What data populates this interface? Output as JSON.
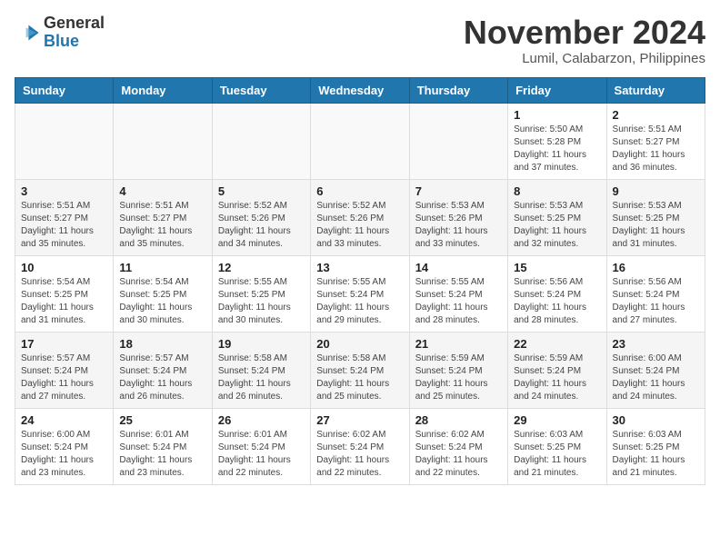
{
  "header": {
    "logo_general": "General",
    "logo_blue": "Blue",
    "month_title": "November 2024",
    "location": "Lumil, Calabarzon, Philippines"
  },
  "weekdays": [
    "Sunday",
    "Monday",
    "Tuesday",
    "Wednesday",
    "Thursday",
    "Friday",
    "Saturday"
  ],
  "weeks": [
    [
      {
        "day": "",
        "info": ""
      },
      {
        "day": "",
        "info": ""
      },
      {
        "day": "",
        "info": ""
      },
      {
        "day": "",
        "info": ""
      },
      {
        "day": "",
        "info": ""
      },
      {
        "day": "1",
        "info": "Sunrise: 5:50 AM\nSunset: 5:28 PM\nDaylight: 11 hours\nand 37 minutes."
      },
      {
        "day": "2",
        "info": "Sunrise: 5:51 AM\nSunset: 5:27 PM\nDaylight: 11 hours\nand 36 minutes."
      }
    ],
    [
      {
        "day": "3",
        "info": "Sunrise: 5:51 AM\nSunset: 5:27 PM\nDaylight: 11 hours\nand 35 minutes."
      },
      {
        "day": "4",
        "info": "Sunrise: 5:51 AM\nSunset: 5:27 PM\nDaylight: 11 hours\nand 35 minutes."
      },
      {
        "day": "5",
        "info": "Sunrise: 5:52 AM\nSunset: 5:26 PM\nDaylight: 11 hours\nand 34 minutes."
      },
      {
        "day": "6",
        "info": "Sunrise: 5:52 AM\nSunset: 5:26 PM\nDaylight: 11 hours\nand 33 minutes."
      },
      {
        "day": "7",
        "info": "Sunrise: 5:53 AM\nSunset: 5:26 PM\nDaylight: 11 hours\nand 33 minutes."
      },
      {
        "day": "8",
        "info": "Sunrise: 5:53 AM\nSunset: 5:25 PM\nDaylight: 11 hours\nand 32 minutes."
      },
      {
        "day": "9",
        "info": "Sunrise: 5:53 AM\nSunset: 5:25 PM\nDaylight: 11 hours\nand 31 minutes."
      }
    ],
    [
      {
        "day": "10",
        "info": "Sunrise: 5:54 AM\nSunset: 5:25 PM\nDaylight: 11 hours\nand 31 minutes."
      },
      {
        "day": "11",
        "info": "Sunrise: 5:54 AM\nSunset: 5:25 PM\nDaylight: 11 hours\nand 30 minutes."
      },
      {
        "day": "12",
        "info": "Sunrise: 5:55 AM\nSunset: 5:25 PM\nDaylight: 11 hours\nand 30 minutes."
      },
      {
        "day": "13",
        "info": "Sunrise: 5:55 AM\nSunset: 5:24 PM\nDaylight: 11 hours\nand 29 minutes."
      },
      {
        "day": "14",
        "info": "Sunrise: 5:55 AM\nSunset: 5:24 PM\nDaylight: 11 hours\nand 28 minutes."
      },
      {
        "day": "15",
        "info": "Sunrise: 5:56 AM\nSunset: 5:24 PM\nDaylight: 11 hours\nand 28 minutes."
      },
      {
        "day": "16",
        "info": "Sunrise: 5:56 AM\nSunset: 5:24 PM\nDaylight: 11 hours\nand 27 minutes."
      }
    ],
    [
      {
        "day": "17",
        "info": "Sunrise: 5:57 AM\nSunset: 5:24 PM\nDaylight: 11 hours\nand 27 minutes."
      },
      {
        "day": "18",
        "info": "Sunrise: 5:57 AM\nSunset: 5:24 PM\nDaylight: 11 hours\nand 26 minutes."
      },
      {
        "day": "19",
        "info": "Sunrise: 5:58 AM\nSunset: 5:24 PM\nDaylight: 11 hours\nand 26 minutes."
      },
      {
        "day": "20",
        "info": "Sunrise: 5:58 AM\nSunset: 5:24 PM\nDaylight: 11 hours\nand 25 minutes."
      },
      {
        "day": "21",
        "info": "Sunrise: 5:59 AM\nSunset: 5:24 PM\nDaylight: 11 hours\nand 25 minutes."
      },
      {
        "day": "22",
        "info": "Sunrise: 5:59 AM\nSunset: 5:24 PM\nDaylight: 11 hours\nand 24 minutes."
      },
      {
        "day": "23",
        "info": "Sunrise: 6:00 AM\nSunset: 5:24 PM\nDaylight: 11 hours\nand 24 minutes."
      }
    ],
    [
      {
        "day": "24",
        "info": "Sunrise: 6:00 AM\nSunset: 5:24 PM\nDaylight: 11 hours\nand 23 minutes."
      },
      {
        "day": "25",
        "info": "Sunrise: 6:01 AM\nSunset: 5:24 PM\nDaylight: 11 hours\nand 23 minutes."
      },
      {
        "day": "26",
        "info": "Sunrise: 6:01 AM\nSunset: 5:24 PM\nDaylight: 11 hours\nand 22 minutes."
      },
      {
        "day": "27",
        "info": "Sunrise: 6:02 AM\nSunset: 5:24 PM\nDaylight: 11 hours\nand 22 minutes."
      },
      {
        "day": "28",
        "info": "Sunrise: 6:02 AM\nSunset: 5:24 PM\nDaylight: 11 hours\nand 22 minutes."
      },
      {
        "day": "29",
        "info": "Sunrise: 6:03 AM\nSunset: 5:25 PM\nDaylight: 11 hours\nand 21 minutes."
      },
      {
        "day": "30",
        "info": "Sunrise: 6:03 AM\nSunset: 5:25 PM\nDaylight: 11 hours\nand 21 minutes."
      }
    ]
  ]
}
